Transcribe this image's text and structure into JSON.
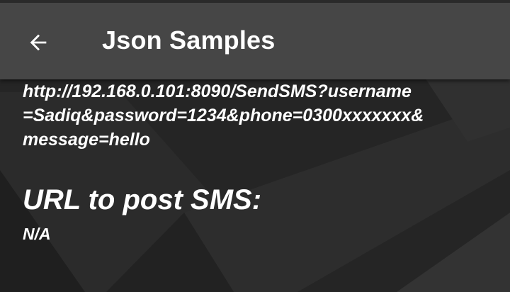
{
  "app_bar": {
    "title": "Json Samples",
    "back_icon": "arrow-left-icon"
  },
  "content": {
    "send_url_lines": [
      "http://192.168.0.101:8090/SendSMS?username",
      "=Sadiq&password=1234&phone=0300xxxxxxx&",
      "message=hello"
    ],
    "post_sms_heading": "URL to post SMS:",
    "post_sms_value": "N/A"
  },
  "colors": {
    "app_bar_bg": "#464646",
    "background": "#262626",
    "text": "#ffffff"
  }
}
